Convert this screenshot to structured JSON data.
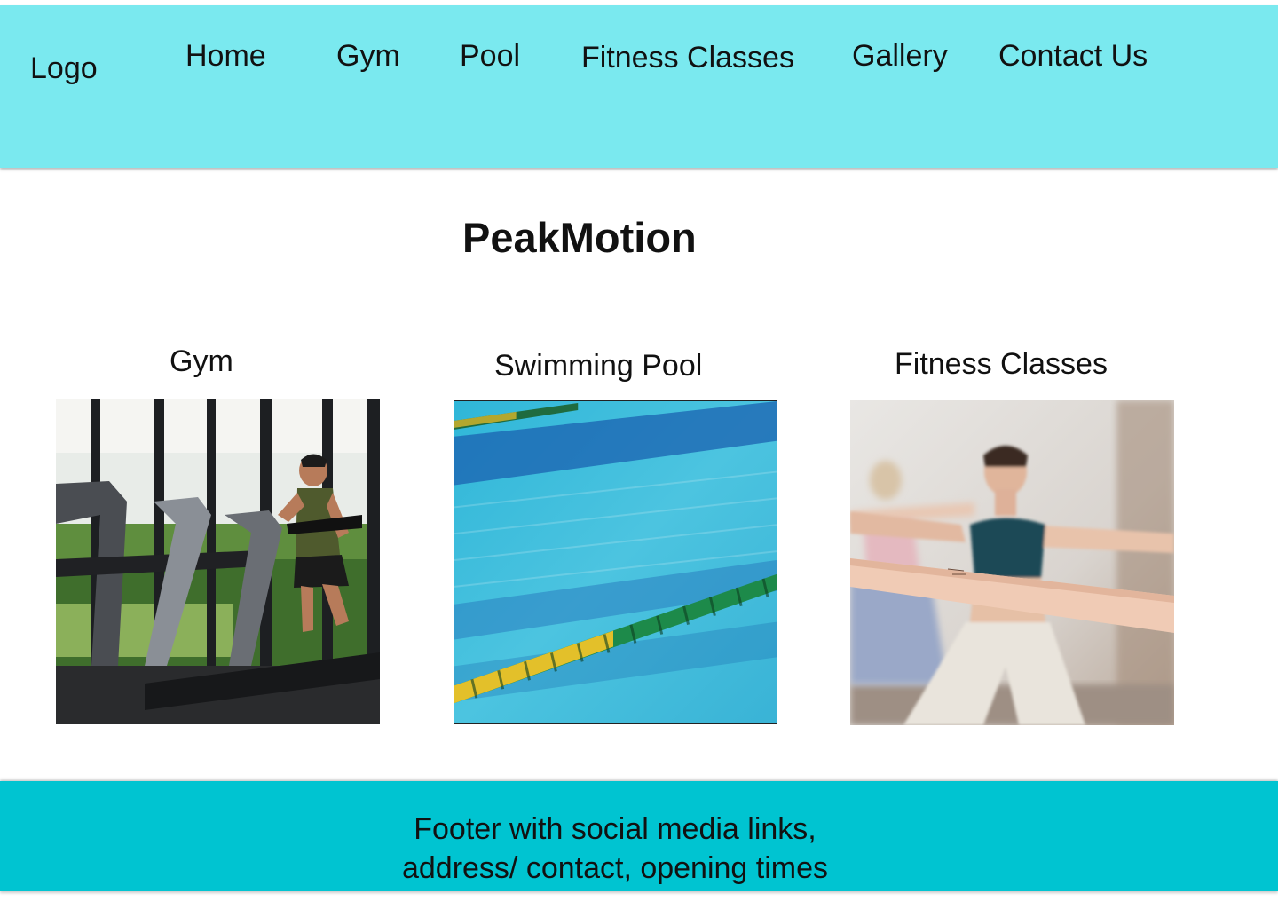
{
  "header": {
    "logo": "Logo",
    "nav": {
      "home": "Home",
      "gym": "Gym",
      "pool": "Pool",
      "fitness_classes": "Fitness Classes",
      "gallery": "Gallery",
      "contact": "Contact Us"
    },
    "background": "#7ae9ef"
  },
  "main": {
    "title": "PeakMotion",
    "sections": {
      "gym": {
        "title": "Gym",
        "image_icon": "gym-treadmill-photo"
      },
      "pool": {
        "title": "Swimming Pool",
        "image_icon": "swimming-pool-photo"
      },
      "classes": {
        "title": "Fitness Classes",
        "image_icon": "yoga-class-photo"
      }
    }
  },
  "footer": {
    "line1": "Footer with social media links,",
    "line2": "address/ contact, opening times",
    "background": "#00c4d1"
  }
}
